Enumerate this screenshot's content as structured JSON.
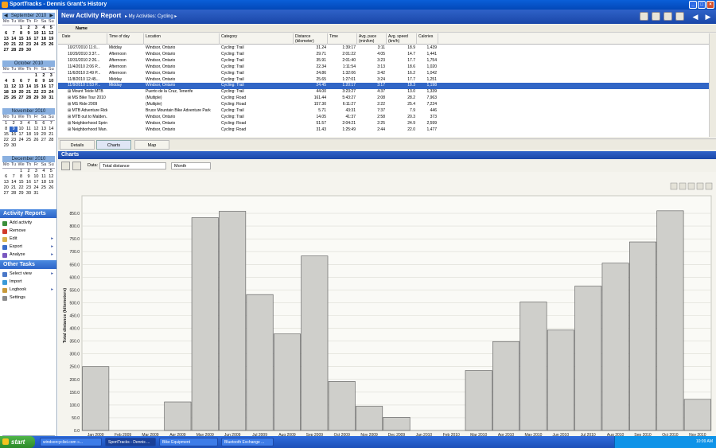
{
  "window": {
    "title": "SportTracks - Dennis Grant's History"
  },
  "calendar": [
    {
      "month": "September 2010",
      "weeks": [
        [
          "",
          "",
          "1",
          "2",
          "3",
          "4",
          "5"
        ],
        [
          "6",
          "7",
          "8",
          "9",
          "10",
          "11",
          "12"
        ],
        [
          "13",
          "14",
          "15",
          "16",
          "17",
          "18",
          "19"
        ],
        [
          "20",
          "21",
          "22",
          "23",
          "24",
          "25",
          "26"
        ],
        [
          "27",
          "28",
          "29",
          "30",
          "",
          "",
          ""
        ]
      ]
    },
    {
      "month": "October 2010",
      "weeks": [
        [
          "",
          "",
          "",
          "",
          "1",
          "2",
          "3"
        ],
        [
          "4",
          "5",
          "6",
          "7",
          "8",
          "9",
          "10"
        ],
        [
          "11",
          "12",
          "13",
          "14",
          "15",
          "16",
          "17"
        ],
        [
          "18",
          "19",
          "20",
          "21",
          "22",
          "23",
          "24"
        ],
        [
          "25",
          "26",
          "27",
          "28",
          "29",
          "30",
          "31"
        ]
      ]
    },
    {
      "month": "November 2010",
      "weeks": [
        [
          "1",
          "2",
          "3",
          "4",
          "5",
          "6",
          "7"
        ],
        [
          "8",
          "9",
          "10",
          "11",
          "12",
          "13",
          "14"
        ],
        [
          "15",
          "16",
          "17",
          "18",
          "19",
          "20",
          "21"
        ],
        [
          "22",
          "23",
          "24",
          "25",
          "26",
          "27",
          "28"
        ],
        [
          "29",
          "30",
          "",
          "",
          "",
          "",
          ""
        ]
      ]
    },
    {
      "month": "December 2010",
      "weeks": [
        [
          "",
          "",
          "1",
          "2",
          "3",
          "4",
          "5"
        ],
        [
          "6",
          "7",
          "8",
          "9",
          "10",
          "11",
          "12"
        ],
        [
          "13",
          "14",
          "15",
          "16",
          "17",
          "18",
          "19"
        ],
        [
          "20",
          "21",
          "22",
          "23",
          "24",
          "25",
          "26"
        ],
        [
          "27",
          "28",
          "29",
          "30",
          "31",
          "",
          ""
        ]
      ]
    }
  ],
  "weekdays": [
    "Mo",
    "Tu",
    "We",
    "Th",
    "Fr",
    "Sa",
    "Su"
  ],
  "activity_reports": {
    "title": "Activity Reports",
    "items": [
      "Add activity",
      "Remove",
      "Edit",
      "Export",
      "Analyze"
    ]
  },
  "other_tasks": {
    "title": "Other Tasks",
    "items": [
      "Select view",
      "Import",
      "Logbook",
      "Settings"
    ]
  },
  "main": {
    "title": "New Activity Report",
    "breadcrumb": "▸ My Activities: Cycling ▸"
  },
  "list_bar": {
    "name_label": "Name"
  },
  "table": {
    "columns": [
      "Date",
      "Time of day",
      "Location",
      "Category",
      "Distance (kilometer)",
      "Time",
      "Avg. pace (min/km)",
      "Avg. speed (km/h)",
      "Calories"
    ],
    "rows": [
      [
        "10/27/2010 11:0...",
        "Midday",
        "Windsor, Ontario",
        "Cycling: Trail",
        "31.24",
        "1:39:17",
        "3:11",
        "18.9",
        "1,439"
      ],
      [
        "10/29/2010 3:37...",
        "Afternoon",
        "Windsor, Ontario",
        "Cycling: Trail",
        "29.71",
        "2:01:22",
        "4:05",
        "14.7",
        "1,441"
      ],
      [
        "10/31/2010 2:26...",
        "Afternoon",
        "Windsor, Ontario",
        "Cycling: Trail",
        "35.91",
        "2:01:40",
        "3:23",
        "17.7",
        "1,754"
      ],
      [
        "11/4/2010 2:06 P...",
        "Afternoon",
        "Windsor, Ontario",
        "Cycling: Trail",
        "22.34",
        "1:11:54",
        "3:13",
        "18.6",
        "1,020"
      ],
      [
        "11/6/2010 2:49 P...",
        "Afternoon",
        "Windsor, Ontario",
        "Cycling: Trail",
        "24.86",
        "1:32:06",
        "3:42",
        "16.2",
        "1,042"
      ],
      [
        "11/8/2010 12:45...",
        "Midday",
        "Windsor, Ontario",
        "Cycling: Trail",
        "25.65",
        "1:27:01",
        "3:24",
        "17.7",
        "1,251"
      ],
      [
        "11/9/2010 1:53 P...",
        "Midday",
        "Windsor, Ontario",
        "Cycling: Trail",
        "24.45",
        "1:20:17",
        "3:17",
        "18.3",
        "1,198"
      ],
      [
        "⊞ Mount Teide MTB",
        "",
        "Puerto de la Cruz, Tenerife",
        "Cycling: Trail",
        "44.00",
        "3:23:27",
        "4:37",
        "13.0",
        "1,339"
      ],
      [
        "⊞ MS Bike Tour 2010",
        "",
        "(Multiple)",
        "Cycling: Road",
        "161.44",
        "5:43:27",
        "2:08",
        "28.2",
        "7,963"
      ],
      [
        "⊞ MS Ride 2009",
        "",
        "(Multiple)",
        "Cycling: Road",
        "157.30",
        "6:11:27",
        "2:22",
        "25.4",
        "7,224"
      ],
      [
        "⊞ MTB Adventure Ride",
        "",
        "Bruce Mountain Bike Adventure Park",
        "Cycling: Trail",
        "5.71",
        "43:31",
        "7:37",
        "7.9",
        "446"
      ],
      [
        "⊞ MTB out to Malden...",
        "",
        "Windsor, Ontario",
        "Cycling: Trail",
        "14.05",
        "41:37",
        "2:58",
        "20.3",
        "373"
      ],
      [
        "⊞ Neighborhood Sprin...",
        "",
        "Windsor, Ontario",
        "Cycling: Road",
        "51.57",
        "2:04:21",
        "2:25",
        "24.9",
        "2,599"
      ],
      [
        "⊞ Neighborhood Wan...",
        "",
        "Windsor, Ontario",
        "Cycling: Road",
        "31.43",
        "1:25:49",
        "2:44",
        "22.0",
        "1,477"
      ]
    ],
    "selected_row": 6
  },
  "tabs": [
    "Details",
    "Charts",
    "Map"
  ],
  "active_tab": 1,
  "charts": {
    "title": "Charts",
    "data_label": "Data:",
    "data_value": "Total distance",
    "period_value": "Month"
  },
  "chart_data": {
    "type": "bar",
    "ylabel": "Total distance (kilometers)",
    "xlabel": "",
    "ylim": [
      0,
      900
    ],
    "yticks": [
      "0.0",
      "50.0",
      "100.0",
      "150.0",
      "200.0",
      "250.0",
      "300.0",
      "350.0",
      "400.0",
      "450.0",
      "500.0",
      "550.0",
      "600.0",
      "650.0",
      "700.0",
      "750.0",
      "800.0",
      "850.0"
    ],
    "categories": [
      "Jan 2009",
      "Feb 2009",
      "Mar 2009",
      "Apr 2009",
      "May 2009",
      "Jun 2009",
      "Jul 2009",
      "Aug 2009",
      "Sep 2009",
      "Oct 2009",
      "Nov 2009",
      "Dec 2009",
      "Jan 2010",
      "Feb 2010",
      "Mar 2010",
      "Apr 2010",
      "May 2010",
      "Jun 2010",
      "Jul 2010",
      "Aug 2010",
      "Sep 2010",
      "Oct 2010",
      "Nov 2010"
    ],
    "values": [
      250,
      0,
      0,
      112,
      833,
      858,
      532,
      378,
      683,
      192,
      95,
      52,
      0,
      0,
      235,
      348,
      503,
      393,
      565,
      655,
      738,
      860,
      122
    ],
    "grid": true,
    "bar_color": "#cfcfcb"
  },
  "taskbar": {
    "start": "start",
    "tasks": [
      "windsorcyclist.com »...",
      "SportTracks - Dennis ...",
      "Bike Equipment",
      "Bluetooth Exchange ..."
    ],
    "active_task": 1,
    "clock": "10:09 AM"
  }
}
